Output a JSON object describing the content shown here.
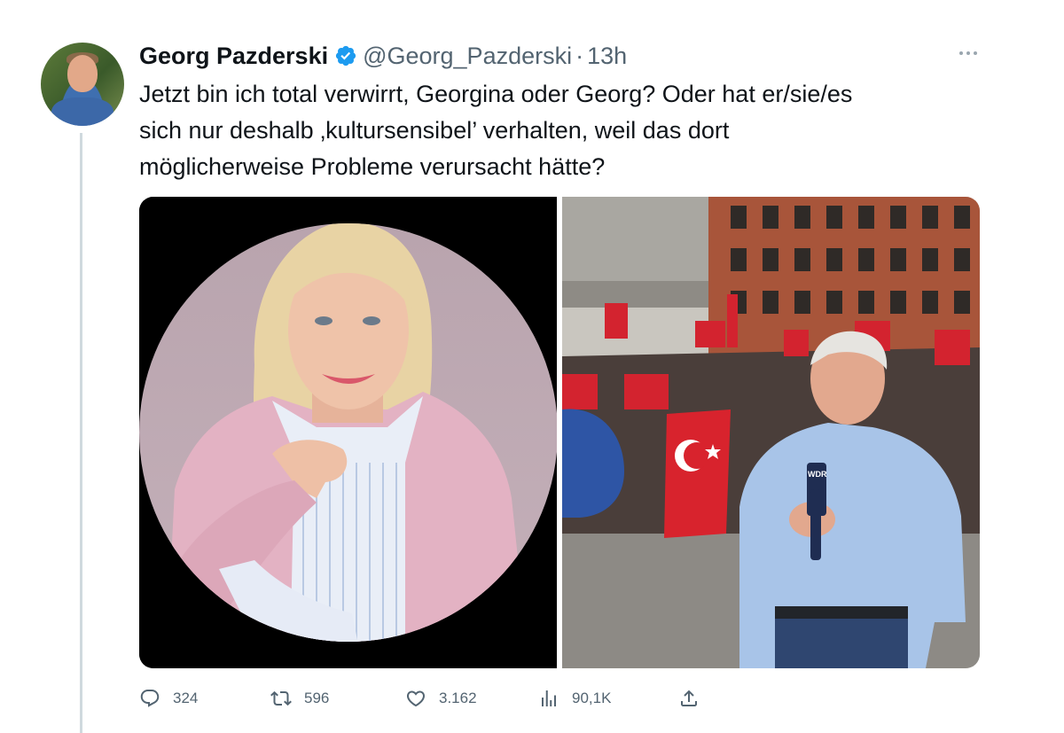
{
  "tweet": {
    "author_name": "Georg Pazderski",
    "handle": "@Georg_Pazderski",
    "separator": "·",
    "time": "13h",
    "text_lines": [
      "Jetzt bin ich total verwirrt, Georgina oder Georg? Oder hat er/sie/es",
      "sich nur deshalb ‚kultursensibel’ verhalten, weil das dort",
      "möglicherweise Probleme verursacht hätte?"
    ],
    "mic_label": "WDR",
    "stats": {
      "replies": "324",
      "retweets": "596",
      "likes": "3.162",
      "views": "90,1K"
    }
  },
  "icons": {
    "verified": "verified-badge-icon",
    "more": "more-options-icon",
    "reply": "reply-icon",
    "retweet": "retweet-icon",
    "like": "heart-icon",
    "views": "views-icon",
    "share": "share-icon"
  },
  "colors": {
    "verified_blue": "#1d9bf0",
    "text_primary": "#0f1419",
    "text_secondary": "#536471"
  }
}
